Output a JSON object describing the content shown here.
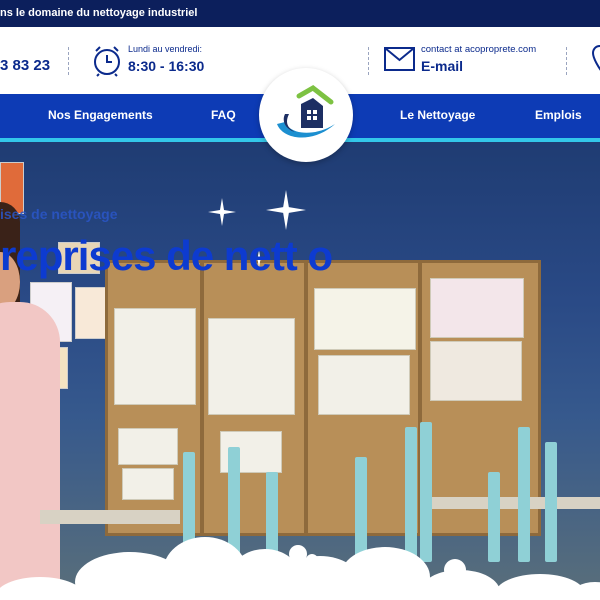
{
  "topbar": {
    "text": "ns le domaine du nettoyage industriel"
  },
  "contact": {
    "phone": "3 83 23",
    "hours_label": "Lundi au vendredi:",
    "hours_value": "8:30 - 16:30",
    "email_label": "contact at acoproprete.com",
    "email_value": "E-mail"
  },
  "nav": {
    "items": [
      "Nos Engagements",
      "FAQ",
      "Le Nettoyage",
      "Emplois"
    ]
  },
  "hero": {
    "kicker": "ises de nettoyage",
    "title": "reprises de nett   o"
  },
  "colors": {
    "nav_bg": "#0d3bb5",
    "accent": "#33c7ea",
    "brand_dark": "#0b2a8c",
    "logo_green": "#7dc242"
  },
  "icons": [
    "clock-icon",
    "mail-icon",
    "map-pin-icon",
    "house-logo"
  ]
}
